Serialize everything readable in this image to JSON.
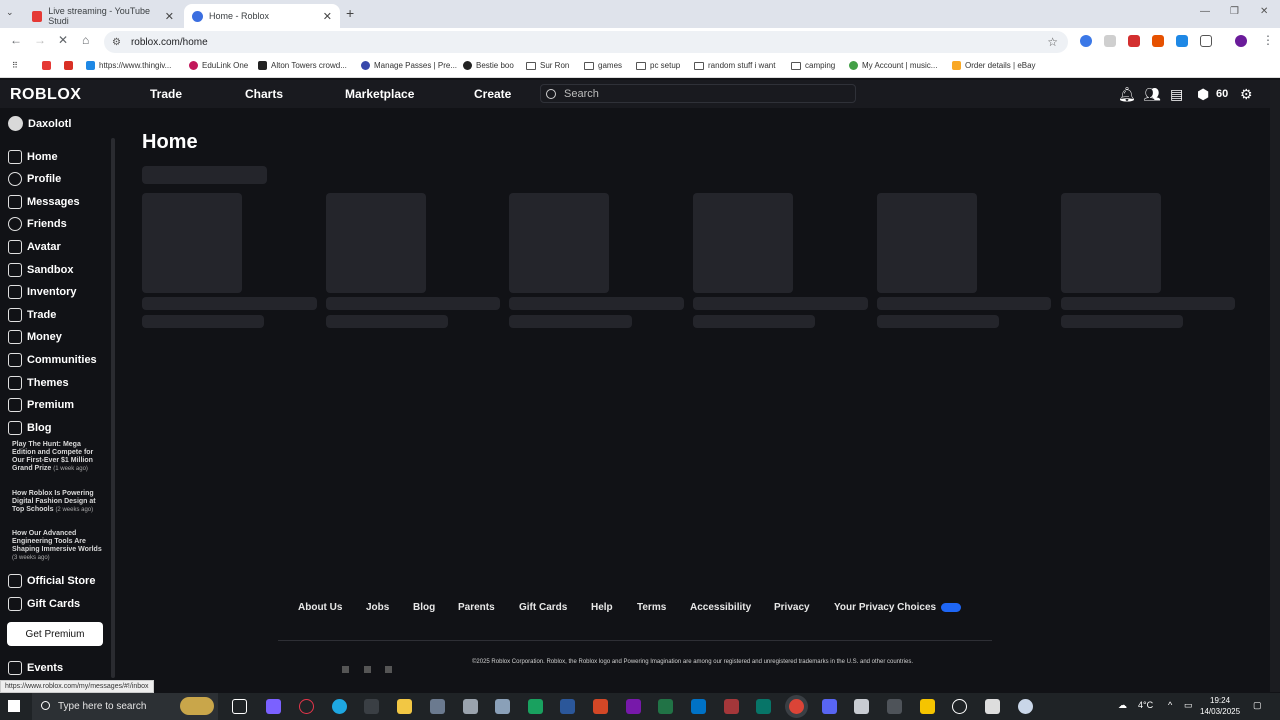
{
  "browser": {
    "tabs": [
      {
        "title": "Live streaming - YouTube Studi",
        "active": false
      },
      {
        "title": "Home - Roblox",
        "active": true
      }
    ],
    "url": "roblox.com/home",
    "bookmarks": [
      "https://www.thingiv...",
      "EduLink One",
      "Alton Towers crowd...",
      "Manage Passes | Pre...",
      "Bestie boo",
      "Sur Ron",
      "games",
      "pc setup",
      "random stuff i want",
      "camping",
      "My Account | music...",
      "Order details | eBay"
    ],
    "status_url": "https://www.roblox.com/my/messages/#!/inbox"
  },
  "topbar": {
    "logo": "ROBLOX",
    "nav": [
      "Trade",
      "Charts",
      "Marketplace",
      "Create"
    ],
    "search_placeholder": "Search",
    "robux": "60"
  },
  "sidebar": {
    "username": "Daxolotl",
    "items": [
      "Home",
      "Profile",
      "Messages",
      "Friends",
      "Avatar",
      "Sandbox",
      "Inventory",
      "Trade",
      "Money",
      "Communities",
      "Themes",
      "Premium",
      "Blog"
    ],
    "blog_posts": [
      {
        "title": "Play The Hunt: Mega Edition and Compete for Our First-Ever $1 Million Grand Prize",
        "ago": "(1 week ago)"
      },
      {
        "title": "How Roblox Is Powering Digital Fashion Design at Top Schools",
        "ago": "(2 weeks ago)"
      },
      {
        "title": "How Our Advanced Engineering Tools Are Shaping Immersive Worlds",
        "ago": "(3 weeks ago)"
      }
    ],
    "bottom_items": [
      "Official Store",
      "Gift Cards"
    ],
    "premium_button": "Get Premium",
    "events": "Events"
  },
  "main": {
    "title": "Home"
  },
  "footer": {
    "links": [
      "About Us",
      "Jobs",
      "Blog",
      "Parents",
      "Gift Cards",
      "Help",
      "Terms",
      "Accessibility",
      "Privacy",
      "Your Privacy Choices"
    ],
    "copyright": "©2025 Roblox Corporation. Roblox, the Roblox logo and Powering Imagination are among our registered and unregistered trademarks in the U.S. and other countries."
  },
  "taskbar": {
    "search_placeholder": "Type here to search",
    "temperature": "4°C",
    "time": "19:24",
    "date": "14/03/2025"
  },
  "colors": {
    "page_bg": "#111216",
    "topbar_bg": "#191a1f",
    "skeleton": "#24252b",
    "accent": "#ffffff"
  }
}
